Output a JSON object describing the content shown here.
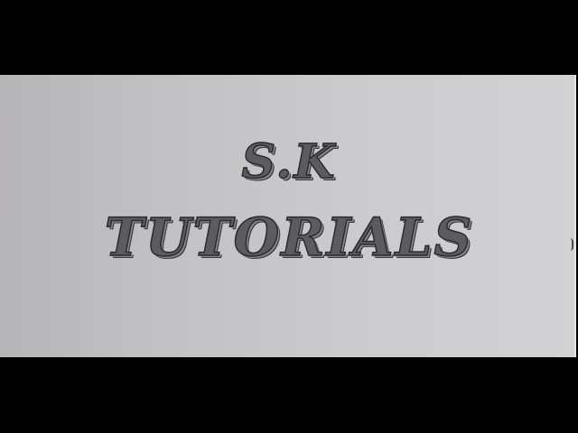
{
  "title": {
    "line1": "S.K",
    "line2": "TUTORIALS"
  },
  "colors": {
    "background": "#000000",
    "panel": "#c5c4c6",
    "text": "#5d5b5e",
    "outline": "#2c2b2e"
  }
}
